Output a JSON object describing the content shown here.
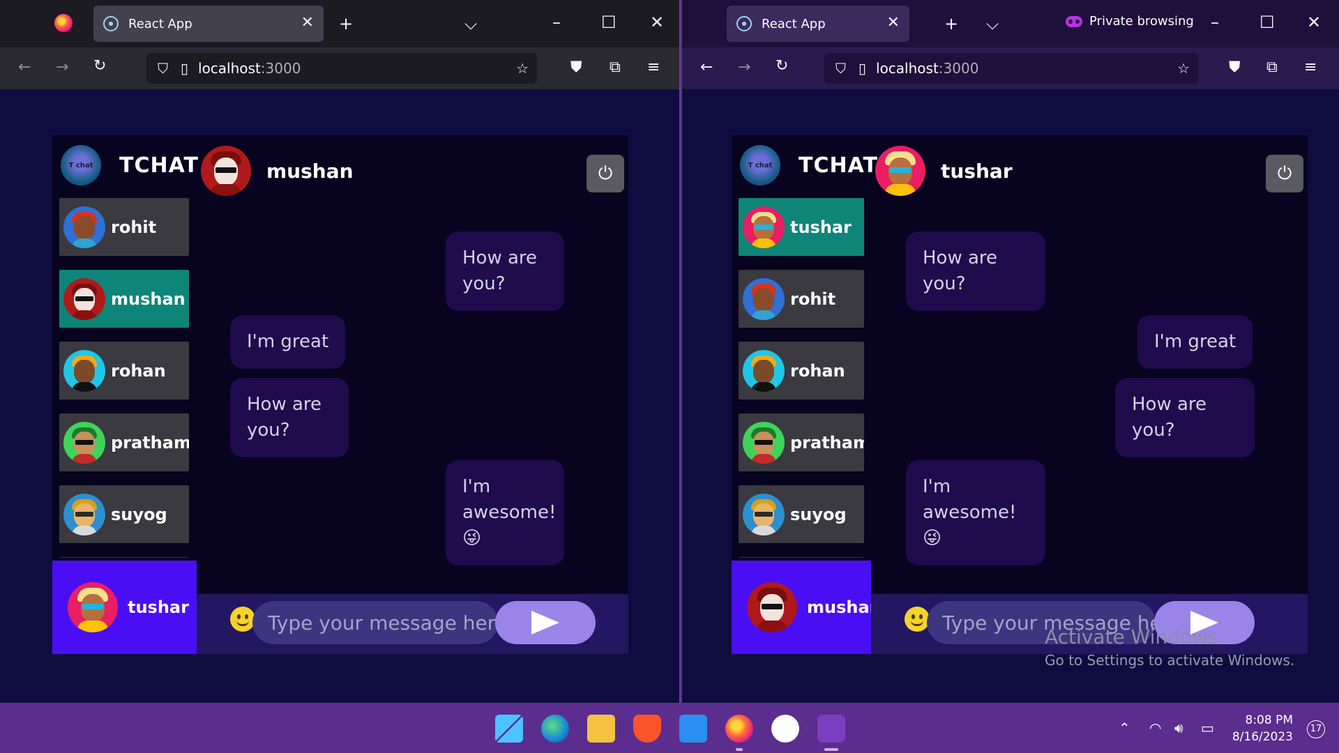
{
  "windows": [
    {
      "tab_title": "React App",
      "url_host": "localhost",
      "url_port": ":3000",
      "private_label": "",
      "app": {
        "brand": "TCHAT",
        "brand_logo_text": "T chat",
        "contacts": [
          {
            "name": "rohit",
            "selected": false
          },
          {
            "name": "mushan",
            "selected": true
          },
          {
            "name": "rohan",
            "selected": false
          },
          {
            "name": "pratham",
            "selected": false
          },
          {
            "name": "suyog",
            "selected": false
          }
        ],
        "current_user": "tushar",
        "chat_with": "mushan",
        "messages": [
          {
            "text": "How are you?",
            "side": "right"
          },
          {
            "text": "I'm great",
            "side": "left"
          },
          {
            "text": "How are you?",
            "side": "left"
          },
          {
            "text": "I'm awesome!😜",
            "side": "right"
          }
        ],
        "input_placeholder": "Type your message here"
      }
    },
    {
      "tab_title": "React App",
      "url_host": "localhost",
      "url_port": ":3000",
      "private_label": "Private browsing",
      "app": {
        "brand": "TCHAT",
        "brand_logo_text": "T chat",
        "contacts": [
          {
            "name": "tushar",
            "selected": true
          },
          {
            "name": "rohit",
            "selected": false
          },
          {
            "name": "rohan",
            "selected": false
          },
          {
            "name": "pratham",
            "selected": false
          },
          {
            "name": "suyog",
            "selected": false
          }
        ],
        "current_user": "mushan",
        "chat_with": "tushar",
        "messages": [
          {
            "text": "How are you?",
            "side": "left"
          },
          {
            "text": "I'm great",
            "side": "right"
          },
          {
            "text": "How are you?",
            "side": "right"
          },
          {
            "text": "I'm awesome!😜",
            "side": "left"
          }
        ],
        "input_placeholder": "Type your message here"
      }
    }
  ],
  "watermark": {
    "line1": "Activate Windows",
    "line2": "Go to Settings to activate Windows."
  },
  "taskbar": {
    "time": "8:08 PM",
    "date": "8/16/2023",
    "notification_count": "17"
  },
  "colors": {
    "selected_contact": "#0e8578",
    "current_user_panel": "#4a0ef5",
    "message_bubble": "#200b4d",
    "send_button": "#9a84e8"
  }
}
